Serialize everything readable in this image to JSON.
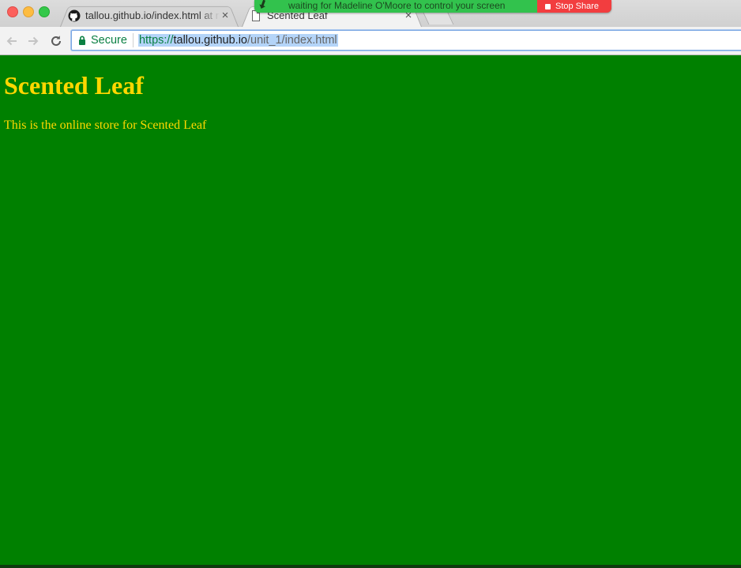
{
  "browser": {
    "tabs": [
      {
        "title": "tallou.github.io/index.html at m",
        "favicon": "github-icon",
        "active": false
      },
      {
        "title": "Scented Leaf",
        "favicon": "document-icon",
        "active": true
      }
    ],
    "tab_close_glyph": "×",
    "omnibox": {
      "secure_label": "Secure",
      "url_scheme": "https://",
      "url_host": "tallou.github.io",
      "url_path": "/unit_1/index.html"
    }
  },
  "share_banner": {
    "message": "waiting for Madeline O'Moore to control your screen",
    "stop_label": "Stop Share"
  },
  "page": {
    "heading": "Scented Leaf",
    "tagline": "This is the online store for Scented Leaf"
  },
  "colors": {
    "page_background": "#008000",
    "page_text": "#ffd700",
    "share_banner": "#32c24d",
    "stop_button": "#f23d3f",
    "secure_green": "#0b8043"
  }
}
